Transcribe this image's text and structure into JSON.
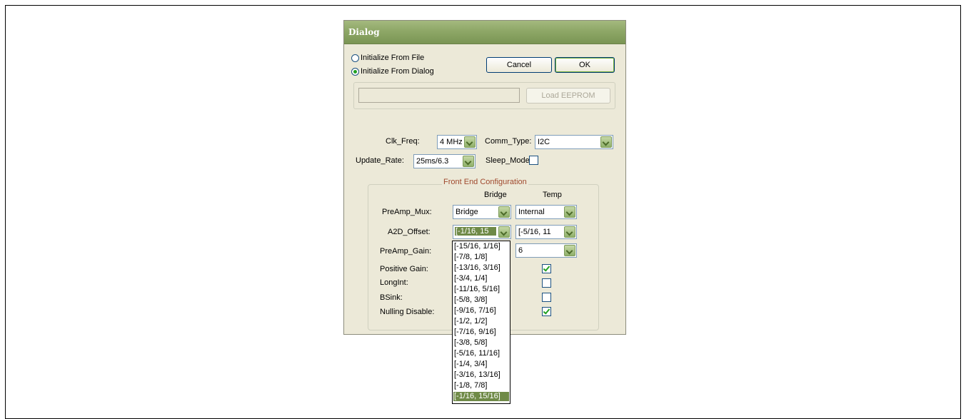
{
  "dialog": {
    "title": "Dialog",
    "radio_file": "Initialize From File",
    "radio_dialog": "Initialize From Dialog",
    "cancel": "Cancel",
    "ok": "OK",
    "path_value": "",
    "load_eeprom": "Load EEPROM",
    "selected_init": "Initialize From Dialog"
  },
  "settings": {
    "clk_freq_label": "Clk_Freq:",
    "clk_freq_value": "4 MHz",
    "comm_type_label": "Comm_Type:",
    "comm_type_value": "I2C",
    "update_rate_label": "Update_Rate:",
    "update_rate_value": "25ms/6.3",
    "sleep_mode_label": "Sleep_Mode",
    "sleep_mode_checked": false
  },
  "front_end": {
    "legend": "Front End Configuration",
    "col_bridge": "Bridge",
    "col_temp": "Temp",
    "preamp_mux_label": "PreAmp_Mux:",
    "preamp_mux_bridge": "Bridge",
    "preamp_mux_temp": "Internal",
    "a2d_offset_label": "A2D_Offset:",
    "a2d_offset_bridge": "[-1/16, 15",
    "a2d_offset_temp": "[-5/16, 11",
    "preamp_gain_label": "PreAmp_Gain:",
    "preamp_gain_temp": "6",
    "positive_gain_label": "Positive Gain:",
    "longint_label": "LongInt:",
    "bsink_label": "BSink:",
    "nulling_label": "Nulling Disable:",
    "positive_gain_temp": true,
    "longint_temp": false,
    "bsink_temp": false,
    "nulling_temp": true
  },
  "dropdown": {
    "options": [
      "[-15/16, 1/16]",
      "[-7/8, 1/8]",
      "[-13/16, 3/16]",
      "[-3/4, 1/4]",
      "[-11/16, 5/16]",
      "[-5/8, 3/8]",
      "[-9/16, 7/16]",
      "[-1/2, 1/2]",
      "[-7/16, 9/16]",
      "[-3/8, 5/8]",
      "[-5/16, 11/16]",
      "[-1/4, 3/4]",
      "[-3/16, 13/16]",
      "[-1/8, 7/8]",
      "[-1/16, 15/16]"
    ],
    "selected": "[-1/16, 15/16]"
  },
  "colors": {
    "titlebar": "#8ea767",
    "selection": "#6f8a47",
    "legend_text": "#a0492e",
    "dialog_bg": "#ece9d8"
  }
}
